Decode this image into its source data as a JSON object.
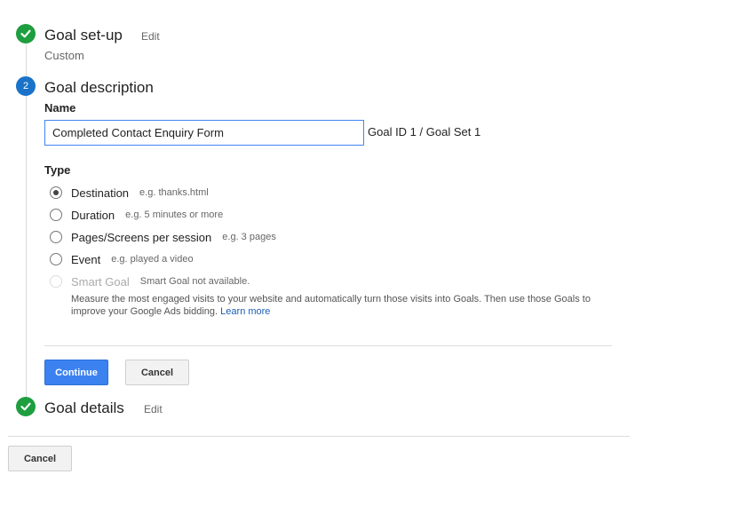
{
  "steps": {
    "setup": {
      "title": "Goal set-up",
      "edit": "Edit",
      "subtitle": "Custom"
    },
    "description": {
      "number": "2",
      "title": "Goal description"
    },
    "details": {
      "title": "Goal details",
      "edit": "Edit"
    }
  },
  "form": {
    "name_label": "Name",
    "name_value": "Completed Contact Enquiry Form",
    "goal_id": "Goal ID 1 / Goal Set 1",
    "type_label": "Type",
    "types": [
      {
        "label": "Destination",
        "hint": "e.g. thanks.html",
        "selected": true
      },
      {
        "label": "Duration",
        "hint": "e.g. 5 minutes or more",
        "selected": false
      },
      {
        "label": "Pages/Screens per session",
        "hint": "e.g. 3 pages",
        "selected": false
      },
      {
        "label": "Event",
        "hint": "e.g. played a video",
        "selected": false
      },
      {
        "label": "Smart Goal",
        "hint": "Smart Goal not available.",
        "selected": false,
        "disabled": true
      }
    ],
    "smart_goal_desc": "Measure the most engaged visits to your website and automatically turn those visits into Goals. Then use those Goals to improve your Google Ads bidding.",
    "learn_more": "Learn more",
    "continue_label": "Continue",
    "cancel_label": "Cancel"
  },
  "footer": {
    "cancel_label": "Cancel"
  }
}
